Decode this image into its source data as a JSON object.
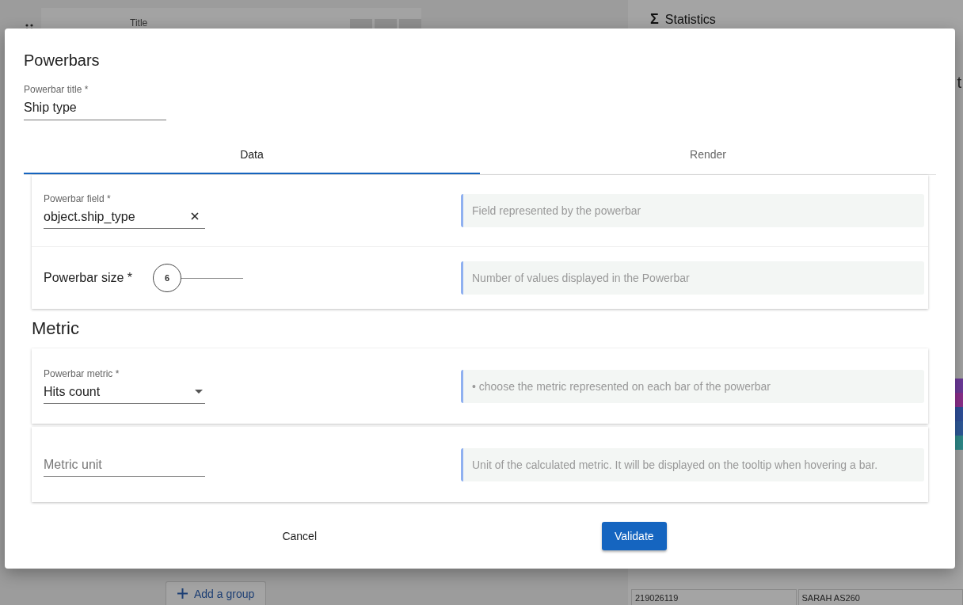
{
  "background": {
    "panel_title": "Title",
    "statistics_icon": "Σ",
    "statistics_title": "Statistics",
    "statistics_cut": "t",
    "add_group_button": "Add a group",
    "cells": [
      "219026119",
      "SARAH AS260"
    ]
  },
  "dialog": {
    "title": "Powerbars",
    "title_field": {
      "label": "Powerbar title *",
      "value": "Ship type"
    },
    "tabs": [
      {
        "label": "Data",
        "selected": true
      },
      {
        "label": "Render",
        "selected": false
      }
    ],
    "field_rows": [
      {
        "kind": "text",
        "label": "Powerbar field *",
        "value": "object.ship_type",
        "clearable": true,
        "help": "Field represented by the powerbar"
      },
      {
        "kind": "slider",
        "label": "Powerbar size *",
        "value": "6",
        "level": 0,
        "help": "Number of values displayed in the Powerbar"
      }
    ],
    "section_title": "Metric",
    "metric_rows": [
      {
        "kind": "select",
        "label": "Powerbar metric *",
        "value": "Hits count",
        "help": "• choose the metric represented on each bar of the powerbar"
      },
      {
        "kind": "text",
        "placeholder": "Metric unit",
        "clearable": false,
        "help": "Unit of the calculated metric. It will be displayed on the tooltip when hovering a bar."
      }
    ],
    "buttons": [
      {
        "kind": "text",
        "label": "Cancel"
      },
      {
        "kind": "primary",
        "label": "Validate"
      }
    ]
  }
}
